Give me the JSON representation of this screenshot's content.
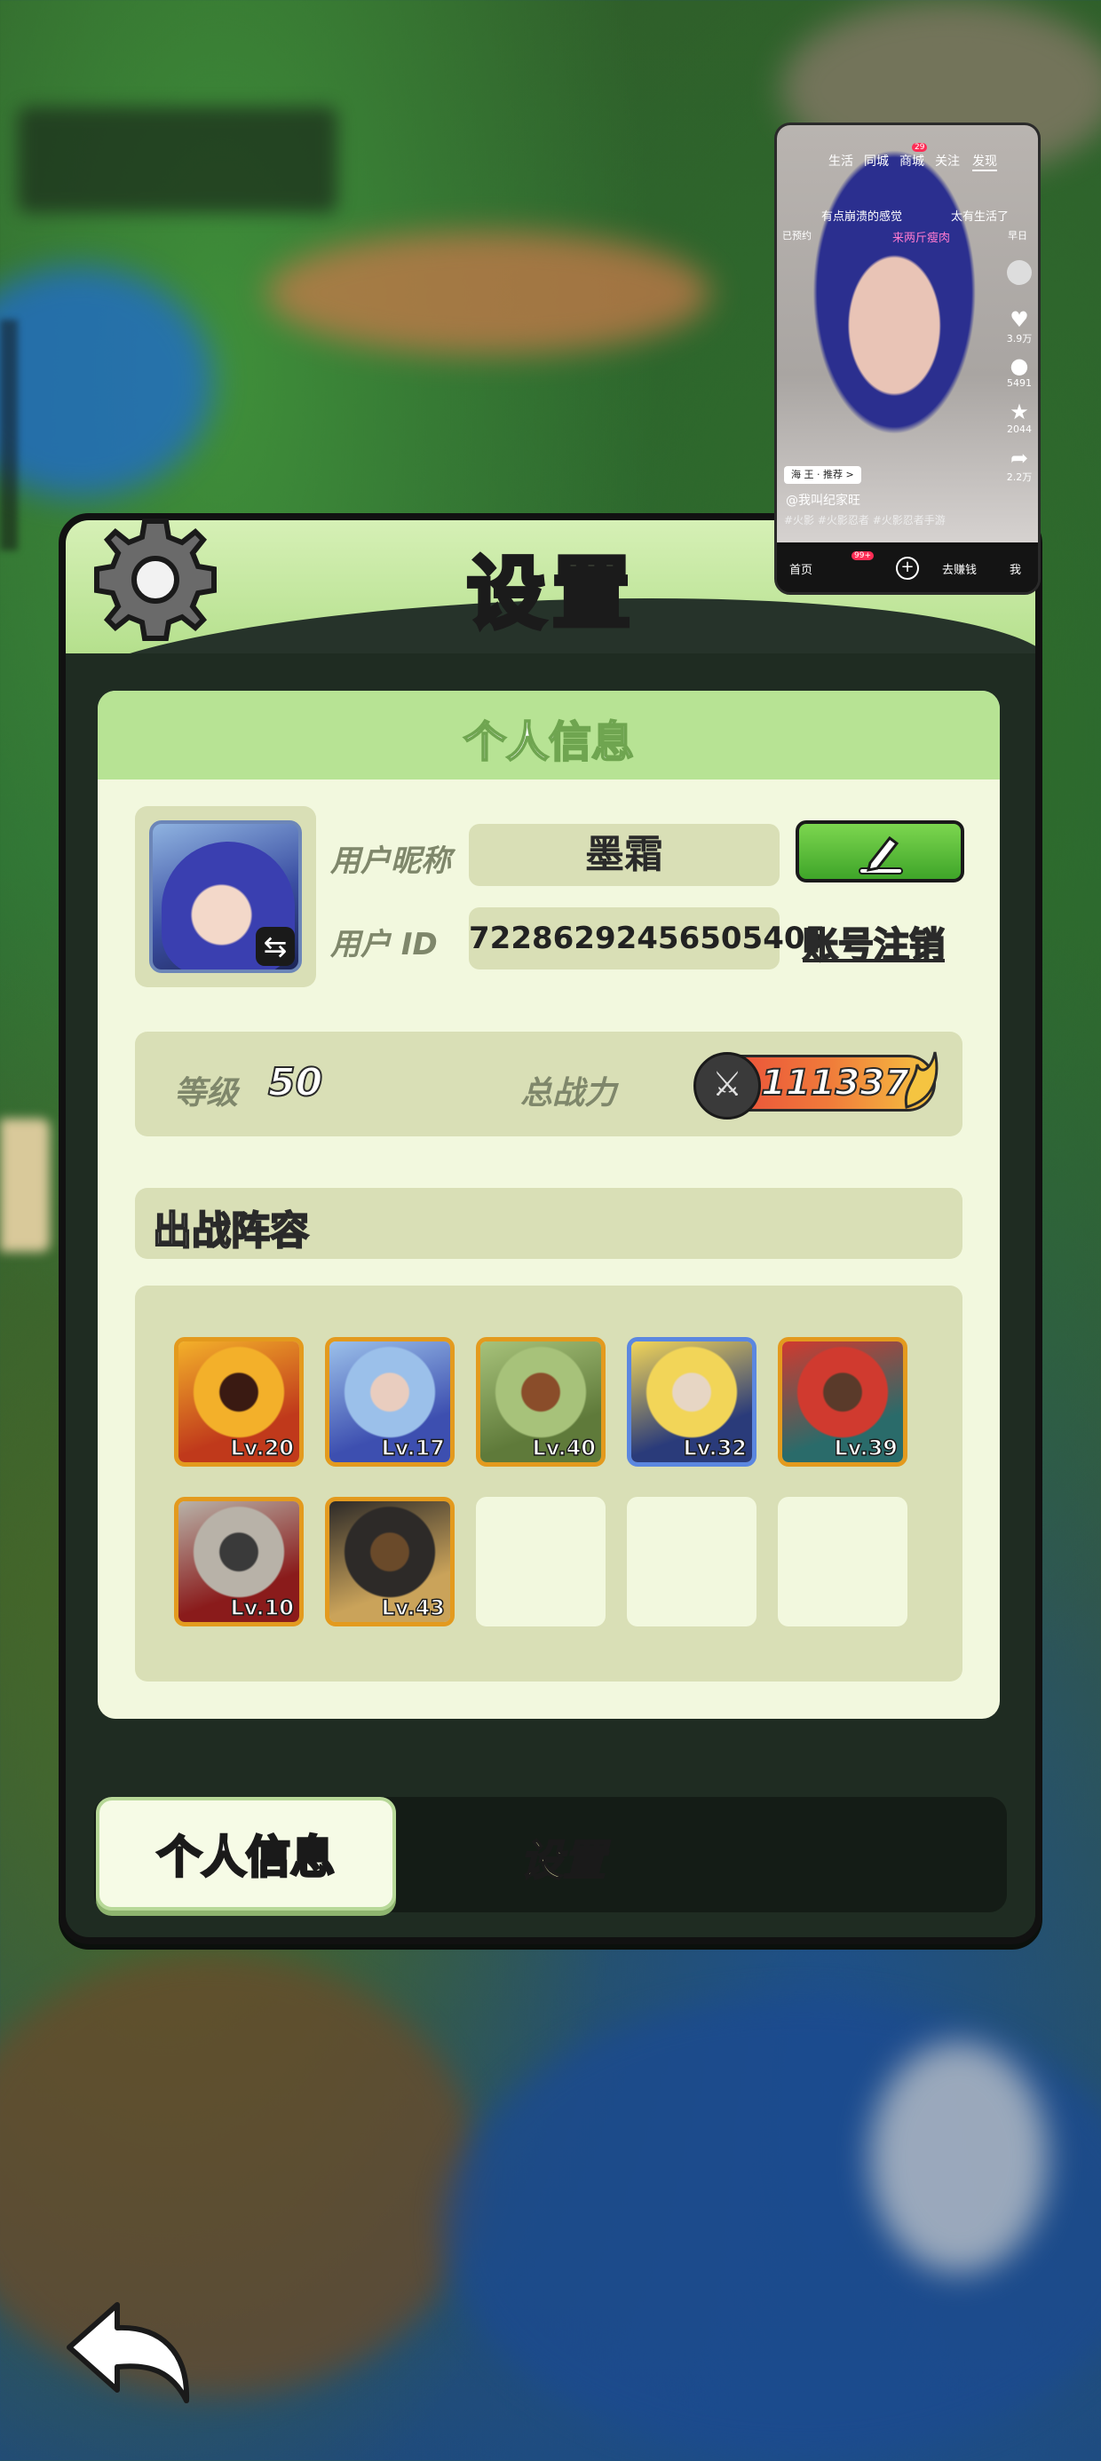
{
  "dialog": {
    "title": "设置"
  },
  "profile": {
    "section_title": "个人信息",
    "nickname_label": "用户昵称",
    "nickname": "墨霜",
    "id_label": "用户 ID",
    "user_id": "72286292456505405",
    "cancel_account": "账号注销"
  },
  "stats": {
    "level_label": "等级",
    "level": "50",
    "power_label": "总战力",
    "power": "111337"
  },
  "lineup": {
    "title": "出战阵容",
    "heroes": [
      {
        "level": "Lv.20",
        "frame": "gold",
        "palette": [
          "#f3b02a",
          "#c0391b",
          "#3a1a12"
        ]
      },
      {
        "level": "Lv.17",
        "frame": "gold",
        "palette": [
          "#9bc0ea",
          "#3d4fb0",
          "#e9cdbf"
        ]
      },
      {
        "level": "Lv.40",
        "frame": "gold",
        "palette": [
          "#a7c27a",
          "#5f7a3a",
          "#8a4d2a"
        ]
      },
      {
        "level": "Lv.32",
        "frame": "blue",
        "palette": [
          "#f2d558",
          "#2a3b7a",
          "#e7d6c4"
        ]
      },
      {
        "level": "Lv.39",
        "frame": "gold",
        "palette": [
          "#d03a2f",
          "#2a6b6a",
          "#5a3a2a"
        ]
      },
      {
        "level": "Lv.10",
        "frame": "gold",
        "palette": [
          "#b8b2a8",
          "#8a1b1b",
          "#3a3a3a"
        ]
      },
      {
        "level": "Lv.43",
        "frame": "gold",
        "palette": [
          "#2d2a28",
          "#caa35a",
          "#6a4a2a"
        ]
      }
    ],
    "empty_slots": 3
  },
  "tabs": {
    "profile": "个人信息",
    "settings": "设置"
  },
  "pip": {
    "tabs": [
      "生活",
      "同城",
      "商城",
      "关注",
      "发现"
    ],
    "badge": "29",
    "line1_left": "有点崩溃的感觉",
    "line1_right": "太有生活了",
    "line2_left": "已预约",
    "line2_mid": "来两斤瘦肉",
    "line2_right": "早日",
    "likes": "3.9万",
    "comments": "5491",
    "favorites": "2044",
    "shares": "2.2万",
    "tag_pill": "海 王 · 推荐 >",
    "author": "@我叫纪家旺",
    "hashtags": "#火影 #火影忍者 #火影忍者手游",
    "bottom_home": "首页",
    "bottom_badge": "99+",
    "bottom_earn": "去赚钱",
    "bottom_me": "我"
  },
  "colors": {
    "accent_green": "#b7e394",
    "card_bg": "#f2f8de",
    "panel_bg": "#d9dfb6",
    "edit_button": "#4fb435",
    "power_badge": "#e8433b"
  }
}
